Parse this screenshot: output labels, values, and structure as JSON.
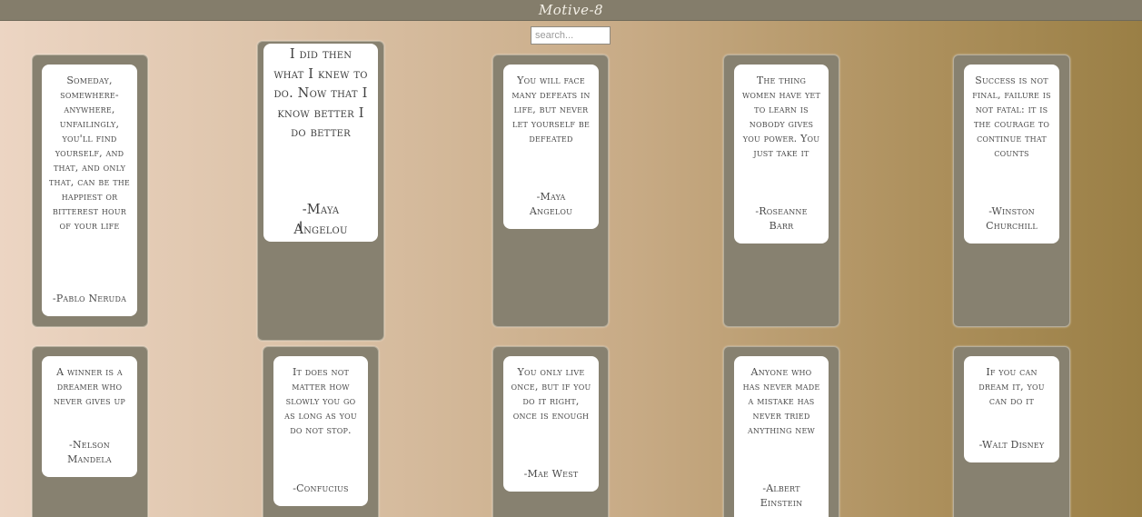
{
  "header": {
    "title": "Motive-8"
  },
  "search": {
    "placeholder": "search..."
  },
  "quotes": [
    {
      "text": "Someday, somewhere-anywhere, unfailingly, you'll find yourself, and that, and only that, can be the happiest or bitterest hour of your life",
      "author": "-Pablo Neruda"
    },
    {
      "text": "I did then what I knew to do. Now that I know better I do better",
      "author": "-Maya Angelou"
    },
    {
      "text": "You will face many defeats in life, but never let yourself be defeated",
      "author": "-Maya Angelou"
    },
    {
      "text": "The thing women have yet to learn is nobody gives you power. You just take it",
      "author": "-Roseanne Barr"
    },
    {
      "text": "Success is not final, failure is not fatal: it is the courage to continue that counts",
      "author": "-Winston Churchill"
    },
    {
      "text": "A winner is a dreamer who never gives up",
      "author": "-Nelson Mandela"
    },
    {
      "text": "It does not matter how slowly you go as long as you do not stop.",
      "author": "-Confucius"
    },
    {
      "text": "You only live once, but if you do it right, once is enough",
      "author": "-Mae West"
    },
    {
      "text": "Anyone who has never made a mistake has never tried anything new",
      "author": "-Albert Einstein"
    },
    {
      "text": "If you can dream it, you can do it",
      "author": "-Walt Disney"
    }
  ]
}
